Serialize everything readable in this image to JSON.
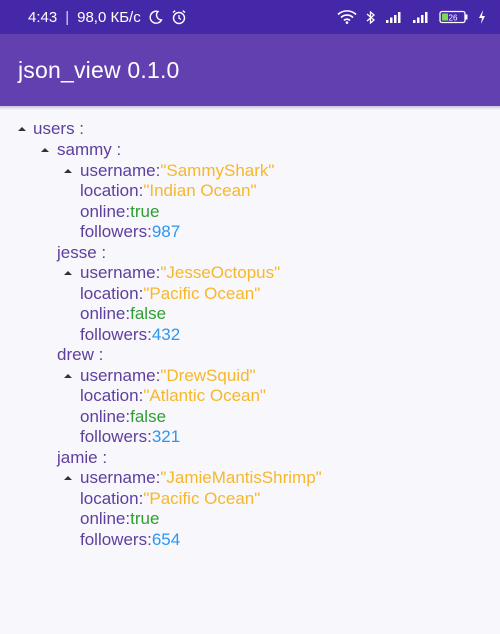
{
  "status_bar": {
    "time": "4:43",
    "net_speed": "98,0 КБ/с",
    "battery": "26"
  },
  "app_bar": {
    "title": "json_view 0.1.0"
  },
  "json": {
    "root_key": "users",
    "users": [
      {
        "key": "sammy",
        "expanded_toggle": true,
        "username": "\"SammyShark\"",
        "location": "\"Indian Ocean\"",
        "online": "true",
        "followers": "987"
      },
      {
        "key": "jesse",
        "expanded_toggle": false,
        "username": "\"JesseOctopus\"",
        "location": "\"Pacific Ocean\"",
        "online": "false",
        "followers": "432"
      },
      {
        "key": "drew",
        "expanded_toggle": false,
        "username": "\"DrewSquid\"",
        "location": "\"Atlantic Ocean\"",
        "online": "false",
        "followers": "321"
      },
      {
        "key": "jamie",
        "expanded_toggle": false,
        "username": "\"JamieMantisShrimp\"",
        "location": "\"Pacific Ocean\"",
        "online": "true",
        "followers": "654"
      }
    ],
    "field_names": {
      "username": "username",
      "location": "location",
      "online": "online",
      "followers": "followers"
    },
    "separator": " : "
  },
  "colors": {
    "key": "#5e3f9e",
    "string": "#f7b72b",
    "bool": "#2e9e33",
    "number": "#2d96f0",
    "app_bar": "#6340b0",
    "status_bar": "#4528a8"
  }
}
